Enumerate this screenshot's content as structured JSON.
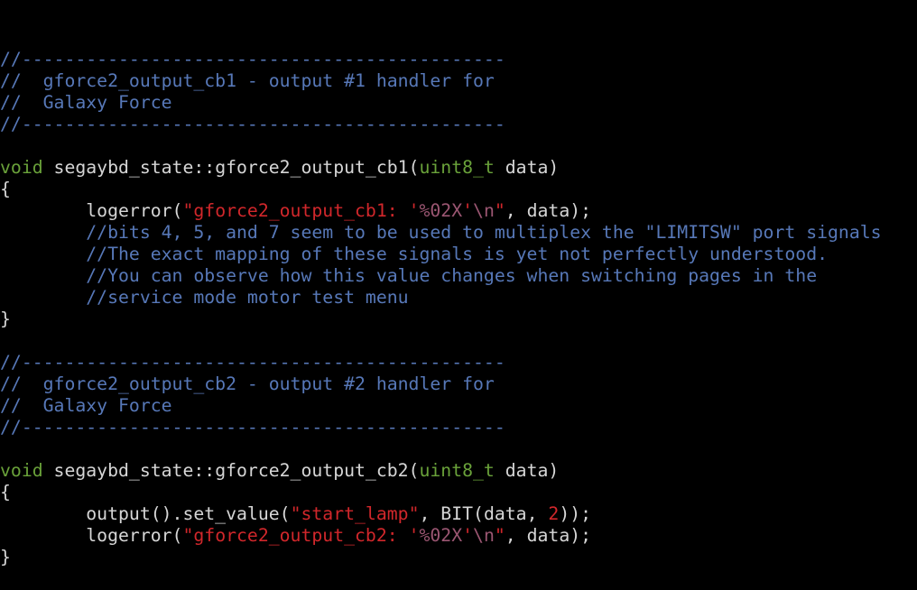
{
  "theme": {
    "background": "#000000",
    "default": "#d6d6d6",
    "comment": "#5778b8",
    "keyword": "#6aa23a",
    "string": "#d1272b",
    "special": "#9b5672",
    "number": "#d1272b"
  },
  "editor": {
    "lines": [
      [
        {
          "c": "comment",
          "t": "//---------------------------------------------"
        }
      ],
      [
        {
          "c": "comment",
          "t": "//  gforce2_output_cb1 - output #1 handler for"
        }
      ],
      [
        {
          "c": "comment",
          "t": "//  Galaxy Force"
        }
      ],
      [
        {
          "c": "comment",
          "t": "//---------------------------------------------"
        }
      ],
      [],
      [
        {
          "c": "keyword",
          "t": "void"
        },
        {
          "c": "default",
          "t": " segaybd_state::gforce2_output_cb1("
        },
        {
          "c": "keyword",
          "t": "uint8_t"
        },
        {
          "c": "default",
          "t": " data)"
        }
      ],
      [
        {
          "c": "default",
          "t": "{"
        }
      ],
      [
        {
          "c": "default",
          "t": "        logerror("
        },
        {
          "c": "string",
          "t": "\"gforce2_output_cb1: '"
        },
        {
          "c": "special",
          "t": "%02X"
        },
        {
          "c": "string",
          "t": "'"
        },
        {
          "c": "special",
          "t": "\\n"
        },
        {
          "c": "string",
          "t": "\""
        },
        {
          "c": "default",
          "t": ", data);"
        }
      ],
      [
        {
          "c": "comment",
          "t": "        //bits 4, 5, and 7 seem to be used to multiplex the \"LIMITSW\" port signals"
        }
      ],
      [
        {
          "c": "comment",
          "t": "        //The exact mapping of these signals is yet not perfectly understood."
        }
      ],
      [
        {
          "c": "comment",
          "t": "        //You can observe how this value changes when switching pages in the"
        }
      ],
      [
        {
          "c": "comment",
          "t": "        //service mode motor test menu"
        }
      ],
      [
        {
          "c": "default",
          "t": "}"
        }
      ],
      [],
      [
        {
          "c": "comment",
          "t": "//---------------------------------------------"
        }
      ],
      [
        {
          "c": "comment",
          "t": "//  gforce2_output_cb2 - output #2 handler for"
        }
      ],
      [
        {
          "c": "comment",
          "t": "//  Galaxy Force"
        }
      ],
      [
        {
          "c": "comment",
          "t": "//---------------------------------------------"
        }
      ],
      [],
      [
        {
          "c": "keyword",
          "t": "void"
        },
        {
          "c": "default",
          "t": " segaybd_state::gforce2_output_cb2("
        },
        {
          "c": "keyword",
          "t": "uint8_t"
        },
        {
          "c": "default",
          "t": " data)"
        }
      ],
      [
        {
          "c": "default",
          "t": "{"
        }
      ],
      [
        {
          "c": "default",
          "t": "        output().set_value("
        },
        {
          "c": "string",
          "t": "\"start_lamp\""
        },
        {
          "c": "default",
          "t": ", BIT(data, "
        },
        {
          "c": "number",
          "t": "2"
        },
        {
          "c": "default",
          "t": "));"
        }
      ],
      [
        {
          "c": "default",
          "t": "        logerror("
        },
        {
          "c": "string",
          "t": "\"gforce2_output_cb2: '"
        },
        {
          "c": "special",
          "t": "%02X"
        },
        {
          "c": "string",
          "t": "'"
        },
        {
          "c": "special",
          "t": "\\n"
        },
        {
          "c": "string",
          "t": "\""
        },
        {
          "c": "default",
          "t": ", data);"
        }
      ],
      [
        {
          "c": "default",
          "t": "}"
        }
      ]
    ]
  }
}
